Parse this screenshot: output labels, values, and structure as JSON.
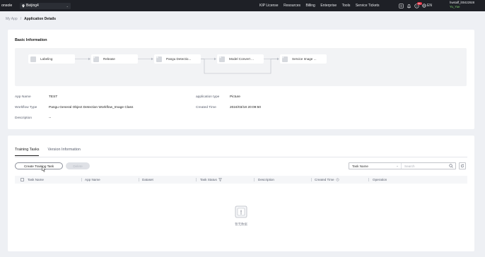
{
  "topbar": {
    "brand": "onsole",
    "region": "Beijing4",
    "nav": [
      "KIP License",
      "Resources",
      "Billing",
      "Enterprise",
      "Tools",
      "Service Tickets"
    ],
    "badge": "99+",
    "lang": "EN",
    "user_name": "hwstaff_l00422928",
    "user_sub": "Yu_Yue"
  },
  "breadcrumb": {
    "root": "My App",
    "sep": "/",
    "current": "Application Details"
  },
  "basic": {
    "title": "Basic Information",
    "nodes": [
      "Labeling",
      "Release",
      "Pangu Detectio...",
      "Model Convert ...",
      "Service Image ..."
    ],
    "fields": {
      "app_name_label": "App Name",
      "app_name": "TEST",
      "workflow_type_label": "Workflow Type",
      "workflow_type": "Pangu General Object Detection Workflow_Image Class",
      "description_label": "Description",
      "description": "--",
      "app_type_label": "application type",
      "app_type": "Picture",
      "created_time_label": "Created Time",
      "created_time": "2024/03/18 20:09:50"
    }
  },
  "tasks": {
    "tabs": [
      "Training Tasks",
      "Version Information"
    ],
    "active_tab": 0,
    "create_label": "Create Training Task",
    "delete_label": "Delete",
    "filter_select": "Task Name",
    "search_placeholder": "Search",
    "columns": [
      "Task Name",
      "App Name",
      "Dataset",
      "Task Status",
      "Description",
      "Created Time",
      "Operation"
    ],
    "empty_text": "暂无数据"
  },
  "colors": {
    "topbar": "#1e2026",
    "accent": "#191919",
    "page_bg": "#eef0f4"
  }
}
